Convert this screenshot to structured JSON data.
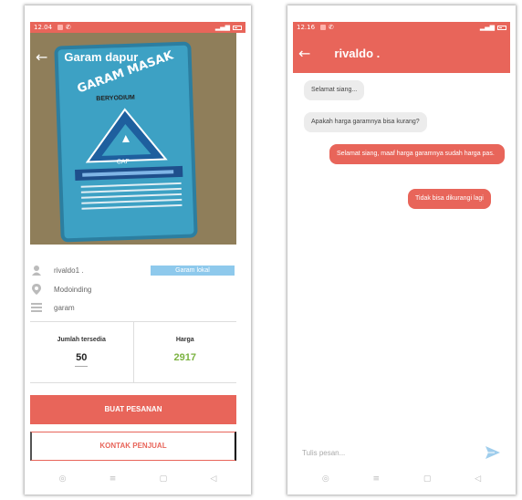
{
  "left": {
    "status": {
      "time": "12.04"
    },
    "toolbar": {
      "title": "Garam dapur"
    },
    "product_image": {
      "brand": "GARAM MASAK",
      "subtitle": "BERYODIUM",
      "cap": "CAP"
    },
    "seller": {
      "name": "rivaldo1 .",
      "location": "Modoinding",
      "product": "garam",
      "category": "Garam lokal"
    },
    "stats": {
      "stock_label": "Jumlah tersedia",
      "stock_value": "50",
      "price_label": "Harga",
      "price_value": "2917"
    },
    "buttons": {
      "order": "BUAT PESANAN",
      "contact": "KONTAK PENJUAL"
    },
    "colors": {
      "accent": "#e8655a",
      "badge": "#8ec9ec",
      "price": "#7cb342"
    }
  },
  "right": {
    "status": {
      "time": "12.16"
    },
    "toolbar": {
      "title": "rivaldo ."
    },
    "messages": [
      {
        "text": "Selamat siang...",
        "direction": "incoming"
      },
      {
        "text": "Apakah harga garamnya bisa kurang?",
        "direction": "incoming"
      },
      {
        "text": "Selamat siang, maaf harga garamnya sudah harga pas.",
        "direction": "outgoing"
      },
      {
        "text": "Tidak bisa dikurangi lagi",
        "direction": "outgoing"
      }
    ],
    "input": {
      "placeholder": "Tulis pesan..."
    }
  }
}
